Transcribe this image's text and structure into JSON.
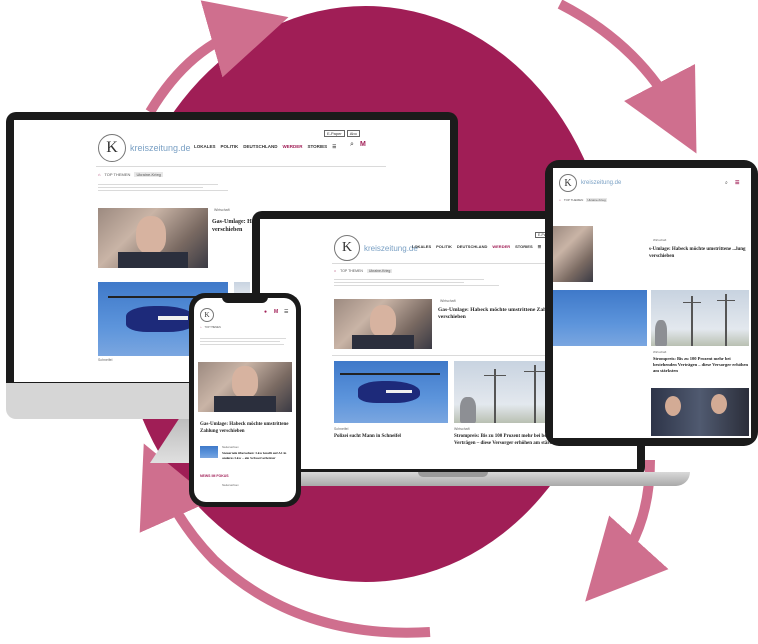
{
  "brand": {
    "logo_letter": "K",
    "domain": "kreiszeitung.de"
  },
  "nav": {
    "items": [
      "LOKALES",
      "POLITIK",
      "DEUTSCHLAND",
      "WERDER",
      "STORIES"
    ],
    "active": "WERDER"
  },
  "topbar": {
    "btn1": "E-Paper",
    "btn2": "Abo"
  },
  "topics": {
    "label": "TOP THEMEN",
    "chip": "Ukraine-Krieg"
  },
  "articles": {
    "lead": {
      "category": "Wirtschaft",
      "headline": "Gas-Umlage: Habeck möchte umstrittene Zahlung verschieben",
      "headline_short": "Gas-Umlage: Ha... verschieben"
    },
    "heli": {
      "category": "Schneifel",
      "headline": "Polizei sucht Mann in Schneifel"
    },
    "power": {
      "category": "Wirtschaft",
      "headline": "Strompreis: Bis zu 100 Prozent mehr bei bestehenden Verträgen – diese Versorger erhöhen am stärksten",
      "headline_tablet": "Strompreis: Bis zu 100 Prozent mehr bei bestehenden Verträgen – diese Versorger erhöhen am stärksten"
    },
    "phone_lead": {
      "headline": "Gas-Umlage: Habeck möchte umstrittene Zahlung verschieben"
    },
    "phone_second": {
      "category": "Niedersachsen",
      "headline": "Steuernde übersehen: Lkw knallt auf A1 in anderes Lkw – ein Schwerverletzter"
    },
    "phone_section": {
      "label": "NEWS IM FOKUS",
      "category": "Niedersachsen"
    }
  },
  "tablet": {
    "headline_top": "s-Umlage: Habeck möchte umstrittene ...lung verschieben"
  },
  "colors": {
    "circle": "#a01e56",
    "arrow": "#cf6f8e",
    "accent": "#a01e56"
  }
}
